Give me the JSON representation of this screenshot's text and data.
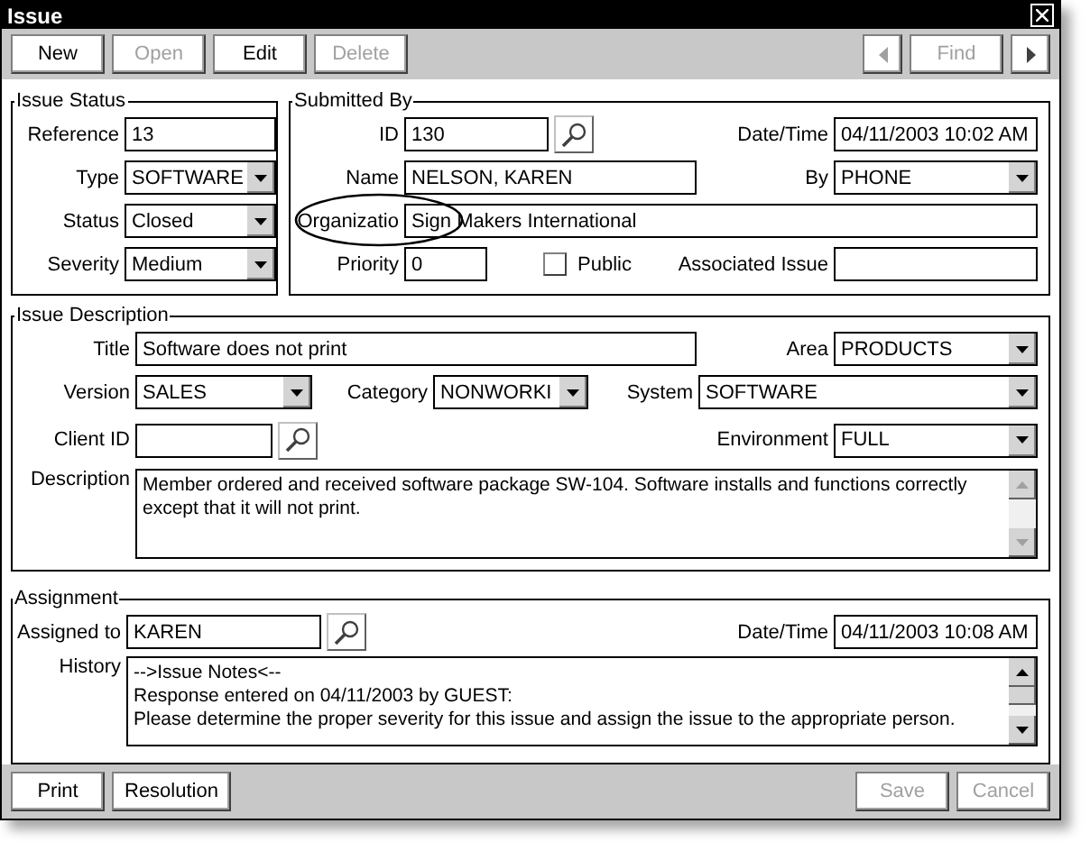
{
  "window": {
    "title": "Issue"
  },
  "toolbar": {
    "buttons": [
      {
        "label": "New",
        "disabled": false
      },
      {
        "label": "Open",
        "disabled": true
      },
      {
        "label": "Edit",
        "disabled": false
      },
      {
        "label": "Delete",
        "disabled": true
      }
    ],
    "previous": {
      "disabled": true
    },
    "find": {
      "label": "Find",
      "disabled": true
    },
    "next": {
      "disabled": false
    }
  },
  "issue_status": {
    "title": "Issue Status",
    "fields": [
      {
        "label": "Reference",
        "value": "13",
        "kind": "text"
      },
      {
        "label": "Type",
        "value": "SOFTWARE",
        "kind": "select"
      },
      {
        "label": "Status",
        "value": "Closed",
        "kind": "select"
      },
      {
        "label": "Severity",
        "value": "Medium",
        "kind": "select"
      }
    ]
  },
  "submitted_by": {
    "title": "Submitted By",
    "id": {
      "label": "ID",
      "value": "130",
      "kind": "lookup"
    },
    "date_time": {
      "label": "Date/Time",
      "value": "04/11/2003 10:02 AM",
      "kind": "text"
    },
    "name": {
      "label": "Name",
      "value": "NELSON, KAREN",
      "kind": "text"
    },
    "by": {
      "label": "By",
      "value": "PHONE",
      "kind": "select"
    },
    "organization": {
      "label": "Organizatio",
      "value": "Sign Makers International",
      "kind": "text",
      "highlighted": true
    },
    "priority": {
      "label": "Priority",
      "value": "0",
      "kind": "text"
    },
    "public": {
      "label": "Public",
      "checked": false
    },
    "associated_issue": {
      "label": "Associated Issue",
      "kind": "text"
    }
  },
  "issue_description": {
    "title": "Issue Description",
    "title_field": {
      "label": "Title",
      "value": "Software does not print",
      "kind": "text"
    },
    "area": {
      "label": "Area",
      "value": "PRODUCTS",
      "kind": "select"
    },
    "version": {
      "label": "Version",
      "value": "SALES",
      "kind": "select"
    },
    "category": {
      "label": "Category",
      "value": "NONWORKI",
      "kind": "select"
    },
    "system": {
      "label": "System",
      "value": "SOFTWARE",
      "kind": "select"
    },
    "client_id": {
      "label": "Client ID",
      "kind": "lookup"
    },
    "environment": {
      "label": "Environment",
      "value": "FULL",
      "kind": "select"
    },
    "description": {
      "label": "Description",
      "lines": [
        "Member ordered and received software package SW-104. Software installs and functions correctly",
        "except that it will not print."
      ]
    }
  },
  "assignment": {
    "title": "Assignment",
    "assigned_to": {
      "label": "Assigned to",
      "value": "KAREN",
      "kind": "lookup"
    },
    "date_time": {
      "label": "Date/Time",
      "value": "04/11/2003 10:08 AM",
      "kind": "text"
    },
    "history": {
      "label": "History",
      "lines": [
        "-->Issue Notes<--",
        "Response entered on 04/11/2003 by GUEST:",
        "Please determine the proper severity for this issue and assign the issue to the appropriate person."
      ]
    }
  },
  "footer": {
    "buttons": [
      {
        "label": "Print",
        "disabled": false
      },
      {
        "label": "Resolution",
        "disabled": false
      },
      {
        "label": "Save",
        "disabled": true
      },
      {
        "label": "Cancel",
        "disabled": true
      }
    ]
  }
}
